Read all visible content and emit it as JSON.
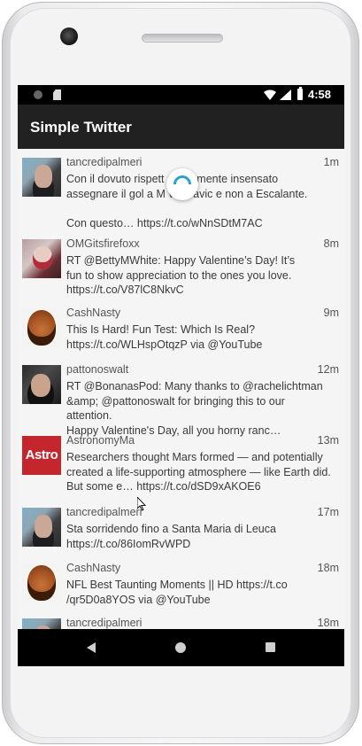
{
  "statusbar": {
    "time": "4:58"
  },
  "appbar": {
    "title": "Simple Twitter"
  },
  "tweets": [
    {
      "user": "tancredipalmeri",
      "ago": "1m",
      "text": "Con il dovuto rispett          solutamente insensato\nassegnare il gol a M          vic-Savic e non a Escalante.\n\nCon questo… https://t.co/wNnSDtM7AC"
    },
    {
      "user": "OMGitsfirefoxx",
      "ago": "8m",
      "text": "RT @BettyMWhite: Happy Valentine’s Day! It’s\nfun to show appreciation to the ones you love.\nhttps://t.co/V87lC8NkvC"
    },
    {
      "user": "CashNasty",
      "ago": "9m",
      "text": "This Is Hard! Fun Test: Which Is Real?\nhttps://t.co/WLHspOtqzP via @YouTube"
    },
    {
      "user": "pattonoswalt",
      "ago": "12m",
      "text": "RT @BonanasPod: Many thanks to @rachelichtman\n&amp; @pattonoswalt for bringing this to our attention.\nHappy Valentine's Day, all you horny ranc…"
    },
    {
      "user": "AstronomyMa",
      "ago": "13m",
      "avatar_text": "Astro",
      "text": "Researchers thought Mars formed — and potentially\ncreated a life-supporting atmosphere — like Earth did.\nBut some e… https://t.co/dSD9xAKOE6"
    },
    {
      "user": "tancredipalmeri",
      "ago": "17m",
      "text": "Sta sorridendo fino a Santa Maria di Leuca\nhttps://t.co/86IomRvWPD"
    },
    {
      "user": "CashNasty",
      "ago": "18m",
      "text": "NFL Best Taunting Moments || HD https://t.co\n/qr5D0a8YOS via @YouTube"
    },
    {
      "user": "tancredipalmeri",
      "ago": "18m",
      "text": ""
    }
  ]
}
